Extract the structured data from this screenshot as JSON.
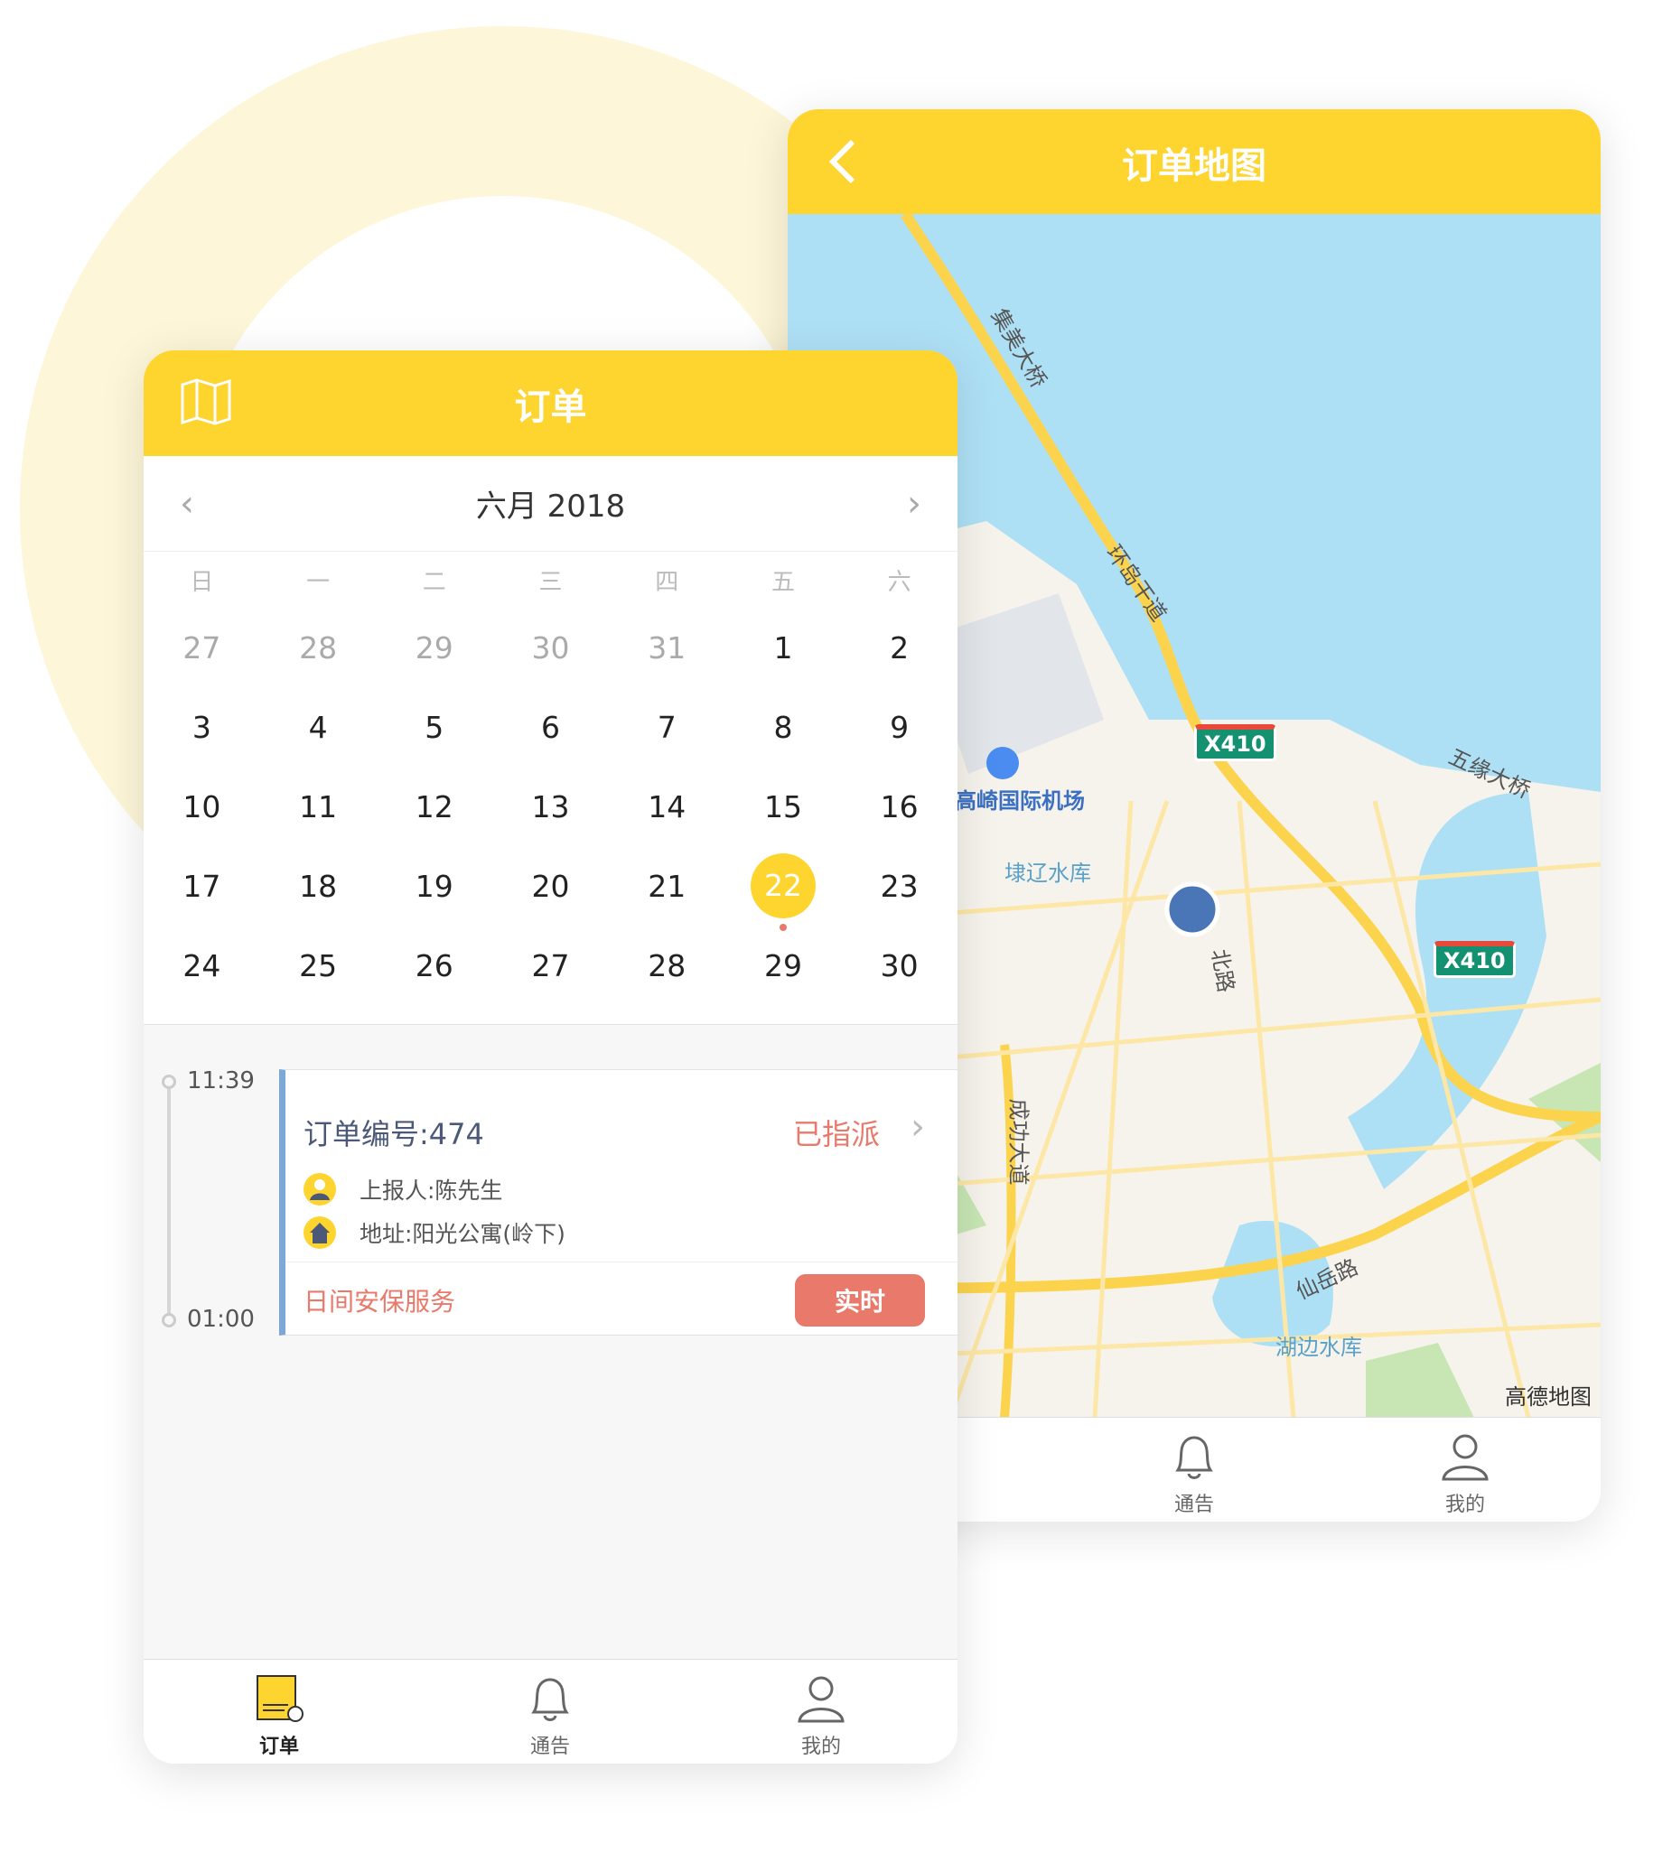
{
  "colors": {
    "accent": "#fed42e",
    "status": "#e8796b",
    "timeline": "#7ba7d9",
    "water": "#aee0f5",
    "land": "#f6f3ec"
  },
  "map_screen": {
    "title": "订单地图",
    "back_icon": "chevron-left-icon",
    "labels": {
      "bridge1": "集美大桥",
      "road1": "环岛干道",
      "airport": "高崎国际机场",
      "reservoir1": "埭辽水库",
      "bridge2": "五缘大桥",
      "shield": "X410",
      "shield2": "X410",
      "road2": "成功大道",
      "road3": "仙岳路",
      "reservoir2": "湖边水库",
      "road4": "北路",
      "attribution": "高德地图"
    },
    "tabs": [
      {
        "label": "通告",
        "icon": "bell-icon"
      },
      {
        "label": "我的",
        "icon": "user-icon"
      }
    ]
  },
  "order_screen": {
    "title": "订单",
    "map_icon": "map-icon",
    "calendar": {
      "month_label": "六月 2018",
      "weekdays": [
        "日",
        "一",
        "二",
        "三",
        "四",
        "五",
        "六"
      ],
      "weeks": [
        [
          "27",
          "28",
          "29",
          "30",
          "31",
          "1",
          "2"
        ],
        [
          "3",
          "4",
          "5",
          "6",
          "7",
          "8",
          "9"
        ],
        [
          "10",
          "11",
          "12",
          "13",
          "14",
          "15",
          "16"
        ],
        [
          "17",
          "18",
          "19",
          "20",
          "21",
          "22",
          "23"
        ],
        [
          "24",
          "25",
          "26",
          "27",
          "28",
          "29",
          "30"
        ]
      ],
      "selected": "22"
    },
    "timeline": {
      "start": "11:39",
      "end": "01:00"
    },
    "order": {
      "id_label": "订单编号:474",
      "status": "已指派",
      "reporter": "上报人:陈先生",
      "address": "地址:阳光公寓(岭下)",
      "service": "日间安保服务",
      "button": "实时"
    },
    "tabs": [
      {
        "label": "订单",
        "icon": "order-icon"
      },
      {
        "label": "通告",
        "icon": "bell-icon"
      },
      {
        "label": "我的",
        "icon": "user-icon"
      }
    ]
  }
}
